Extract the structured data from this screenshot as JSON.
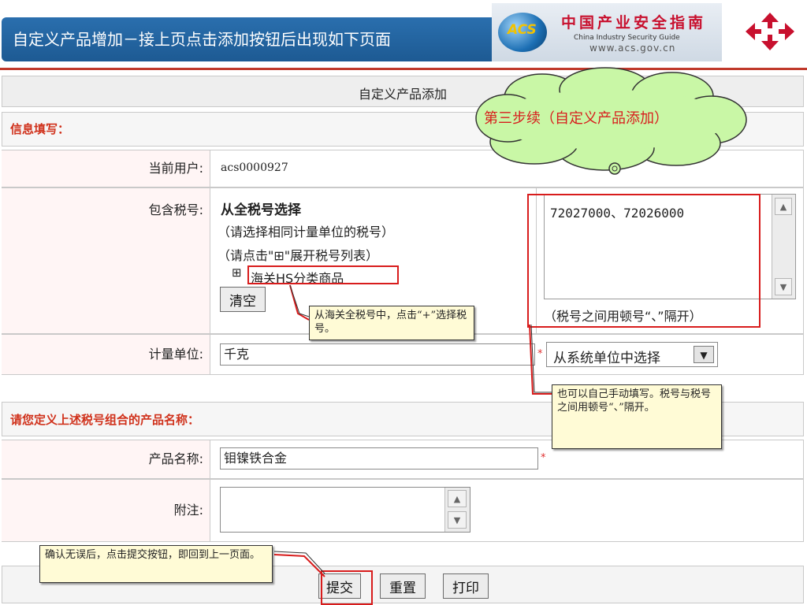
{
  "header": {
    "slide_title": "自定义产品增加－接上页点击添加按钮后出现如下页面",
    "acs_logo_text": "ACS",
    "cn_name": "中国产业安全指南",
    "en_name": "China Industry Security Guide",
    "site_url": "www.acs.gov.cn"
  },
  "form": {
    "title": "自定义产品添加",
    "section_info": "信息填写：",
    "current_user_label": "当前用户:",
    "current_user_value": "acs0000927",
    "tax_codes_label": "包含税号:",
    "select_all_heading": "从全税号选择",
    "hint_same_unit": "（请选择相同计量单位的税号）",
    "hint_expand": "（请点击\"⊞\"展开税号列表）",
    "tree_expand_glyph": "⊞",
    "tree_item": "海关HS分类商品",
    "clear_button": "清空",
    "tax_codes_value": "72027000、72026000",
    "separator_hint": "（税号之间用顿号“、”隔开）",
    "unit_label": "计量单位:",
    "unit_value": "千克",
    "unit_select_value": "从系统单位中选择",
    "required_mark": "*",
    "section_name": "请您定义上述税号组合的产品名称：",
    "product_name_label": "产品名称:",
    "product_name_value": "钼镍铁合金",
    "remark_label": "附注:",
    "submit_button": "提交",
    "reset_button": "重置",
    "print_button": "打印"
  },
  "callouts": {
    "cloud_step": "第三步续（自定义产品添加）",
    "hs_note": "从海关全税号中，点击“+”选择税号。",
    "manual_note": "也可以自己手动填写。税号与税号之间用顿号“、”隔开。",
    "submit_note": "确认无误后，点击提交按钮，即回到上一页面。"
  },
  "colors": {
    "title_bar": "#1d5a93",
    "section_text": "#d0321c",
    "highlight": "#d81c1c",
    "note_bg": "#fffbd6",
    "cloud_bg": "#c9f7a6"
  }
}
